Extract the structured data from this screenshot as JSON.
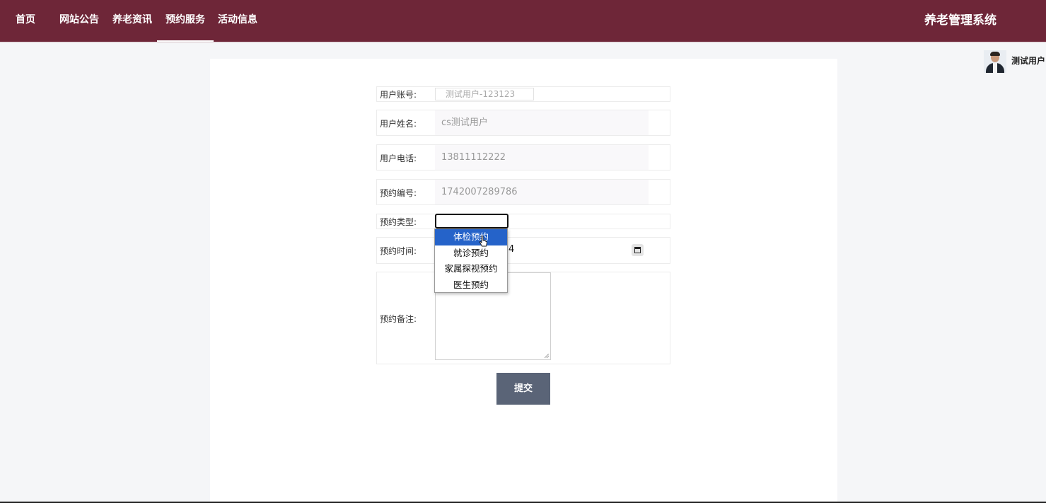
{
  "nav": {
    "items": [
      "首页",
      "网站公告",
      "养老资讯",
      "预约服务",
      "活动信息"
    ],
    "active_index": 3,
    "brand": "养老管理系统"
  },
  "user": {
    "name": "测试用户"
  },
  "form": {
    "account": {
      "label": "用户账号:",
      "value": "测试用户-123123"
    },
    "name": {
      "label": "用户姓名:",
      "value": "cs测试用户"
    },
    "phone": {
      "label": "用户电话:",
      "value": "13811112222"
    },
    "booking_no": {
      "label": "预约编号:",
      "value": "1742007289786"
    },
    "type": {
      "label": "预约类型:",
      "value": "",
      "options": [
        "体检预约",
        "就诊预约",
        "家属探视预约",
        "医生预约"
      ],
      "highlighted_index": 0
    },
    "time": {
      "label": "预约时间:",
      "value_fragment": "4"
    },
    "remark": {
      "label": "预约备注:",
      "value": ""
    },
    "submit_label": "提交"
  },
  "colors": {
    "topbar": "#6e2638",
    "submit": "#5a6477",
    "option_highlight": "#2563c9"
  },
  "icons": [
    "calendar-icon",
    "cursor-pointer-icon",
    "avatar-photo"
  ]
}
